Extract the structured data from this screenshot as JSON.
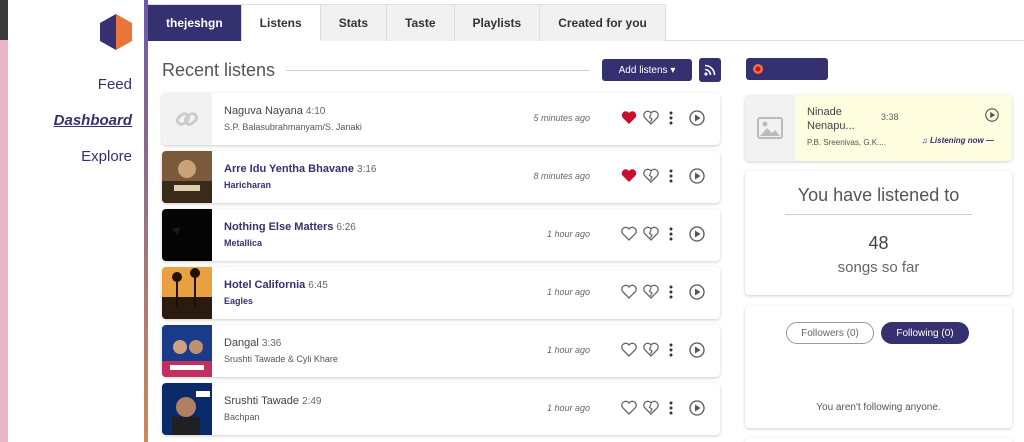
{
  "sidebar": {
    "nav": [
      {
        "label": "Feed"
      },
      {
        "label": "Dashboard"
      },
      {
        "label": "Explore"
      }
    ]
  },
  "tabs": [
    {
      "label": "thejeshgn"
    },
    {
      "label": "Listens"
    },
    {
      "label": "Stats"
    },
    {
      "label": "Taste"
    },
    {
      "label": "Playlists"
    },
    {
      "label": "Created for you"
    }
  ],
  "recent": {
    "title": "Recent listens",
    "add_label": "Add listens ▾",
    "listens": [
      {
        "track": "Naguva Nayana",
        "duration": "4:10",
        "artist": "S.P. Balasubrahmanyam/S. Janaki",
        "time": "5 minutes ago",
        "loved": true,
        "linked": false
      },
      {
        "track": "Arre Idu Yentha Bhavane",
        "duration": "3:16",
        "artist": "Haricharan",
        "time": "8 minutes ago",
        "loved": true,
        "linked": true
      },
      {
        "track": "Nothing Else Matters",
        "duration": "6:26",
        "artist": "Metallica",
        "time": "1 hour ago",
        "loved": false,
        "linked": true
      },
      {
        "track": "Hotel California",
        "duration": "6:45",
        "artist": "Eagles",
        "time": "1 hour ago",
        "loved": false,
        "linked": true
      },
      {
        "track": "Dangal",
        "duration": "3:36",
        "artist": "Srushti Tawade & Cyli Khare",
        "time": "1 hour ago",
        "loved": false,
        "linked": false
      },
      {
        "track": "Srushti Tawade",
        "duration": "2:49",
        "artist": "Bachpan",
        "time": "1 hour ago",
        "loved": false,
        "linked": false
      }
    ]
  },
  "now_playing": {
    "title": "Ninade Nenapu...",
    "duration": "3:38",
    "artist": "P.B. Sreenivas, G.K....",
    "status": "♫ Listening now —"
  },
  "stats": {
    "title": "You have listened to",
    "count": "48",
    "subtitle": "songs so far"
  },
  "follow": {
    "followers_label": "Followers (0)",
    "following_label": "Following (0)",
    "empty_text": "You aren't following anyone."
  },
  "colors": {
    "brand": "#353070",
    "love": "#c8102e",
    "accent": "#eb743b"
  }
}
